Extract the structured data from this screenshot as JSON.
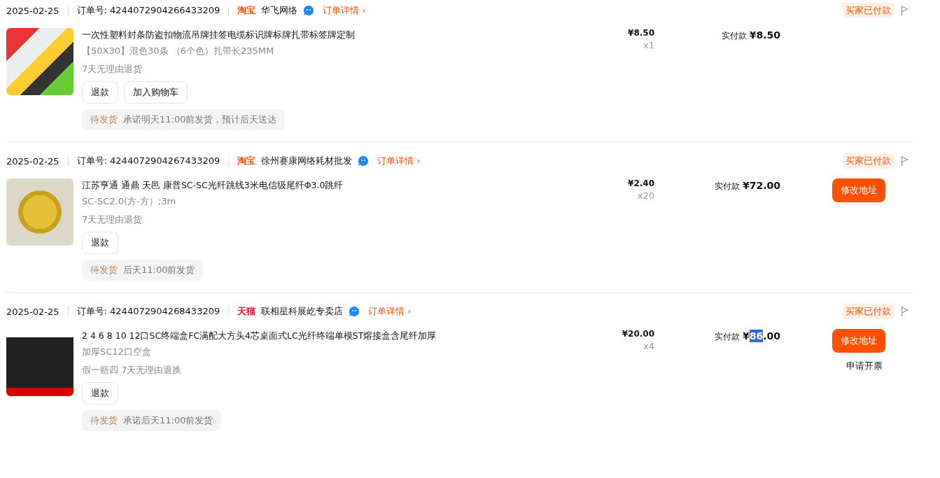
{
  "orders": [
    {
      "date": "2025-02-25",
      "order_no": "订单号: 4244072904266433209",
      "platform": {
        "kind": "taobao",
        "label": "淘宝"
      },
      "shop": "华飞网络",
      "detail_link": "订单详情 ›",
      "status": "买家已付款",
      "item": {
        "photo": {
          "kind": "tags"
        },
        "title": "一次性塑料封条防盗扣物流吊牌挂签电缆标识牌标牌扎带标签牌定制",
        "spec": "【50X30】混色30条 （6个色）扎带长235MM",
        "service": "7天无理由退货",
        "buttons": [
          "退款",
          "加入购物车"
        ],
        "ship_status": "待发货",
        "ship_note": "承诺明天11:00前发货，预计后天送达"
      },
      "price": "¥8.50",
      "quantity": "x1",
      "paid_label": "实付款",
      "paid_parts": [
        {
          "text": "¥8.50",
          "highlighted": false
        }
      ]
    },
    {
      "date": "2025-02-25",
      "order_no": "订单号: 4244072904267433209",
      "platform": {
        "kind": "taobao",
        "label": "淘宝"
      },
      "shop": "徐州赛康网络耗材批发",
      "detail_link": "订单详情 ›",
      "status": "买家已付款",
      "item": {
        "photo": {
          "kind": "cable"
        },
        "title": "江苏亨通 通鼎 天邑 康普SC-SC光纤跳线3米电信级尾纤Φ3.0跳纤",
        "spec": "SC-SC2.0(方-方）;3m",
        "service": "7天无理由退货",
        "buttons": [
          "退款"
        ],
        "ship_status": "待发货",
        "ship_note": "后天11:00前发货"
      },
      "price": "¥2.40",
      "quantity": "x20",
      "paid_label": "实付款",
      "paid_parts": [
        {
          "text": "¥72.00",
          "highlighted": false
        }
      ],
      "actions": [
        {
          "kind": "primary",
          "label": "修改地址"
        }
      ]
    },
    {
      "date": "2025-02-25",
      "order_no": "订单号: 4244072904268433209",
      "platform": {
        "kind": "tmall",
        "label": "天猫"
      },
      "shop": "联相星科展屹专卖店",
      "detail_link": "订单详情 ›",
      "status": "买家已付款",
      "item": {
        "photo": {
          "kind": "box"
        },
        "title": "2 4 6 8 10 12口SC终端盒FC满配大方头4芯桌面式LC光纤终端单模ST熔接盒含尾纤加厚",
        "spec": "加厚SC12口空盒",
        "service": "假一赔四 7天无理由退换",
        "buttons": [
          "退款"
        ],
        "ship_status": "待发货",
        "ship_note": "承诺后天11:00前发货"
      },
      "price": "¥20.00",
      "quantity": "x4",
      "paid_label": "实付款",
      "paid_parts": [
        {
          "text": "¥",
          "highlighted": false
        },
        {
          "text": "86",
          "highlighted": true
        },
        {
          "text": ".00",
          "highlighted": false
        }
      ],
      "actions": [
        {
          "kind": "primary",
          "label": "修改地址"
        },
        {
          "kind": "link",
          "label": "申请开票"
        }
      ]
    }
  ]
}
